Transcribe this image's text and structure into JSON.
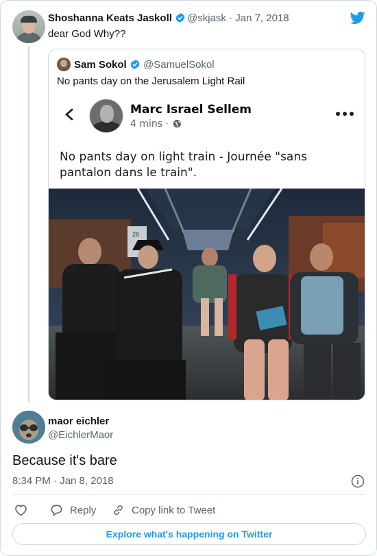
{
  "parent_tweet": {
    "author_name": "Shoshanna Keats Jaskoll",
    "handle_date": "@skjask · Jan 7, 2018",
    "text": "dear God Why??"
  },
  "quoted_tweet": {
    "author_name": "Sam Sokol",
    "handle": "@SamuelSokol",
    "text": "No pants day on the Jerusalem Light Rail",
    "facebook_post": {
      "author_name": "Marc Israel Sellem",
      "time": "4 mins ·",
      "text": "No pants day on light train - Journée \"sans pantalon dans le train\".",
      "photo_car_number": "28"
    }
  },
  "main_tweet": {
    "author_name": "maor eichler",
    "handle": "@EichlerMaor",
    "text": "Because it's bare",
    "timestamp": "8:34 PM · Jan 8, 2018"
  },
  "actions": {
    "reply_label": "Reply",
    "copy_link_label": "Copy link to Tweet"
  },
  "explore_label": "Explore what's happening on Twitter",
  "colors": {
    "twitter_blue": "#1d9bf0",
    "text_primary": "#0f1419",
    "text_secondary": "#536471",
    "border": "#cfd9de"
  },
  "icons": [
    "twitter-logo-icon",
    "verified-badge-icon",
    "back-chevron-icon",
    "globe-icon",
    "more-dots-icon",
    "info-icon",
    "heart-icon",
    "reply-bubble-icon",
    "link-icon"
  ]
}
